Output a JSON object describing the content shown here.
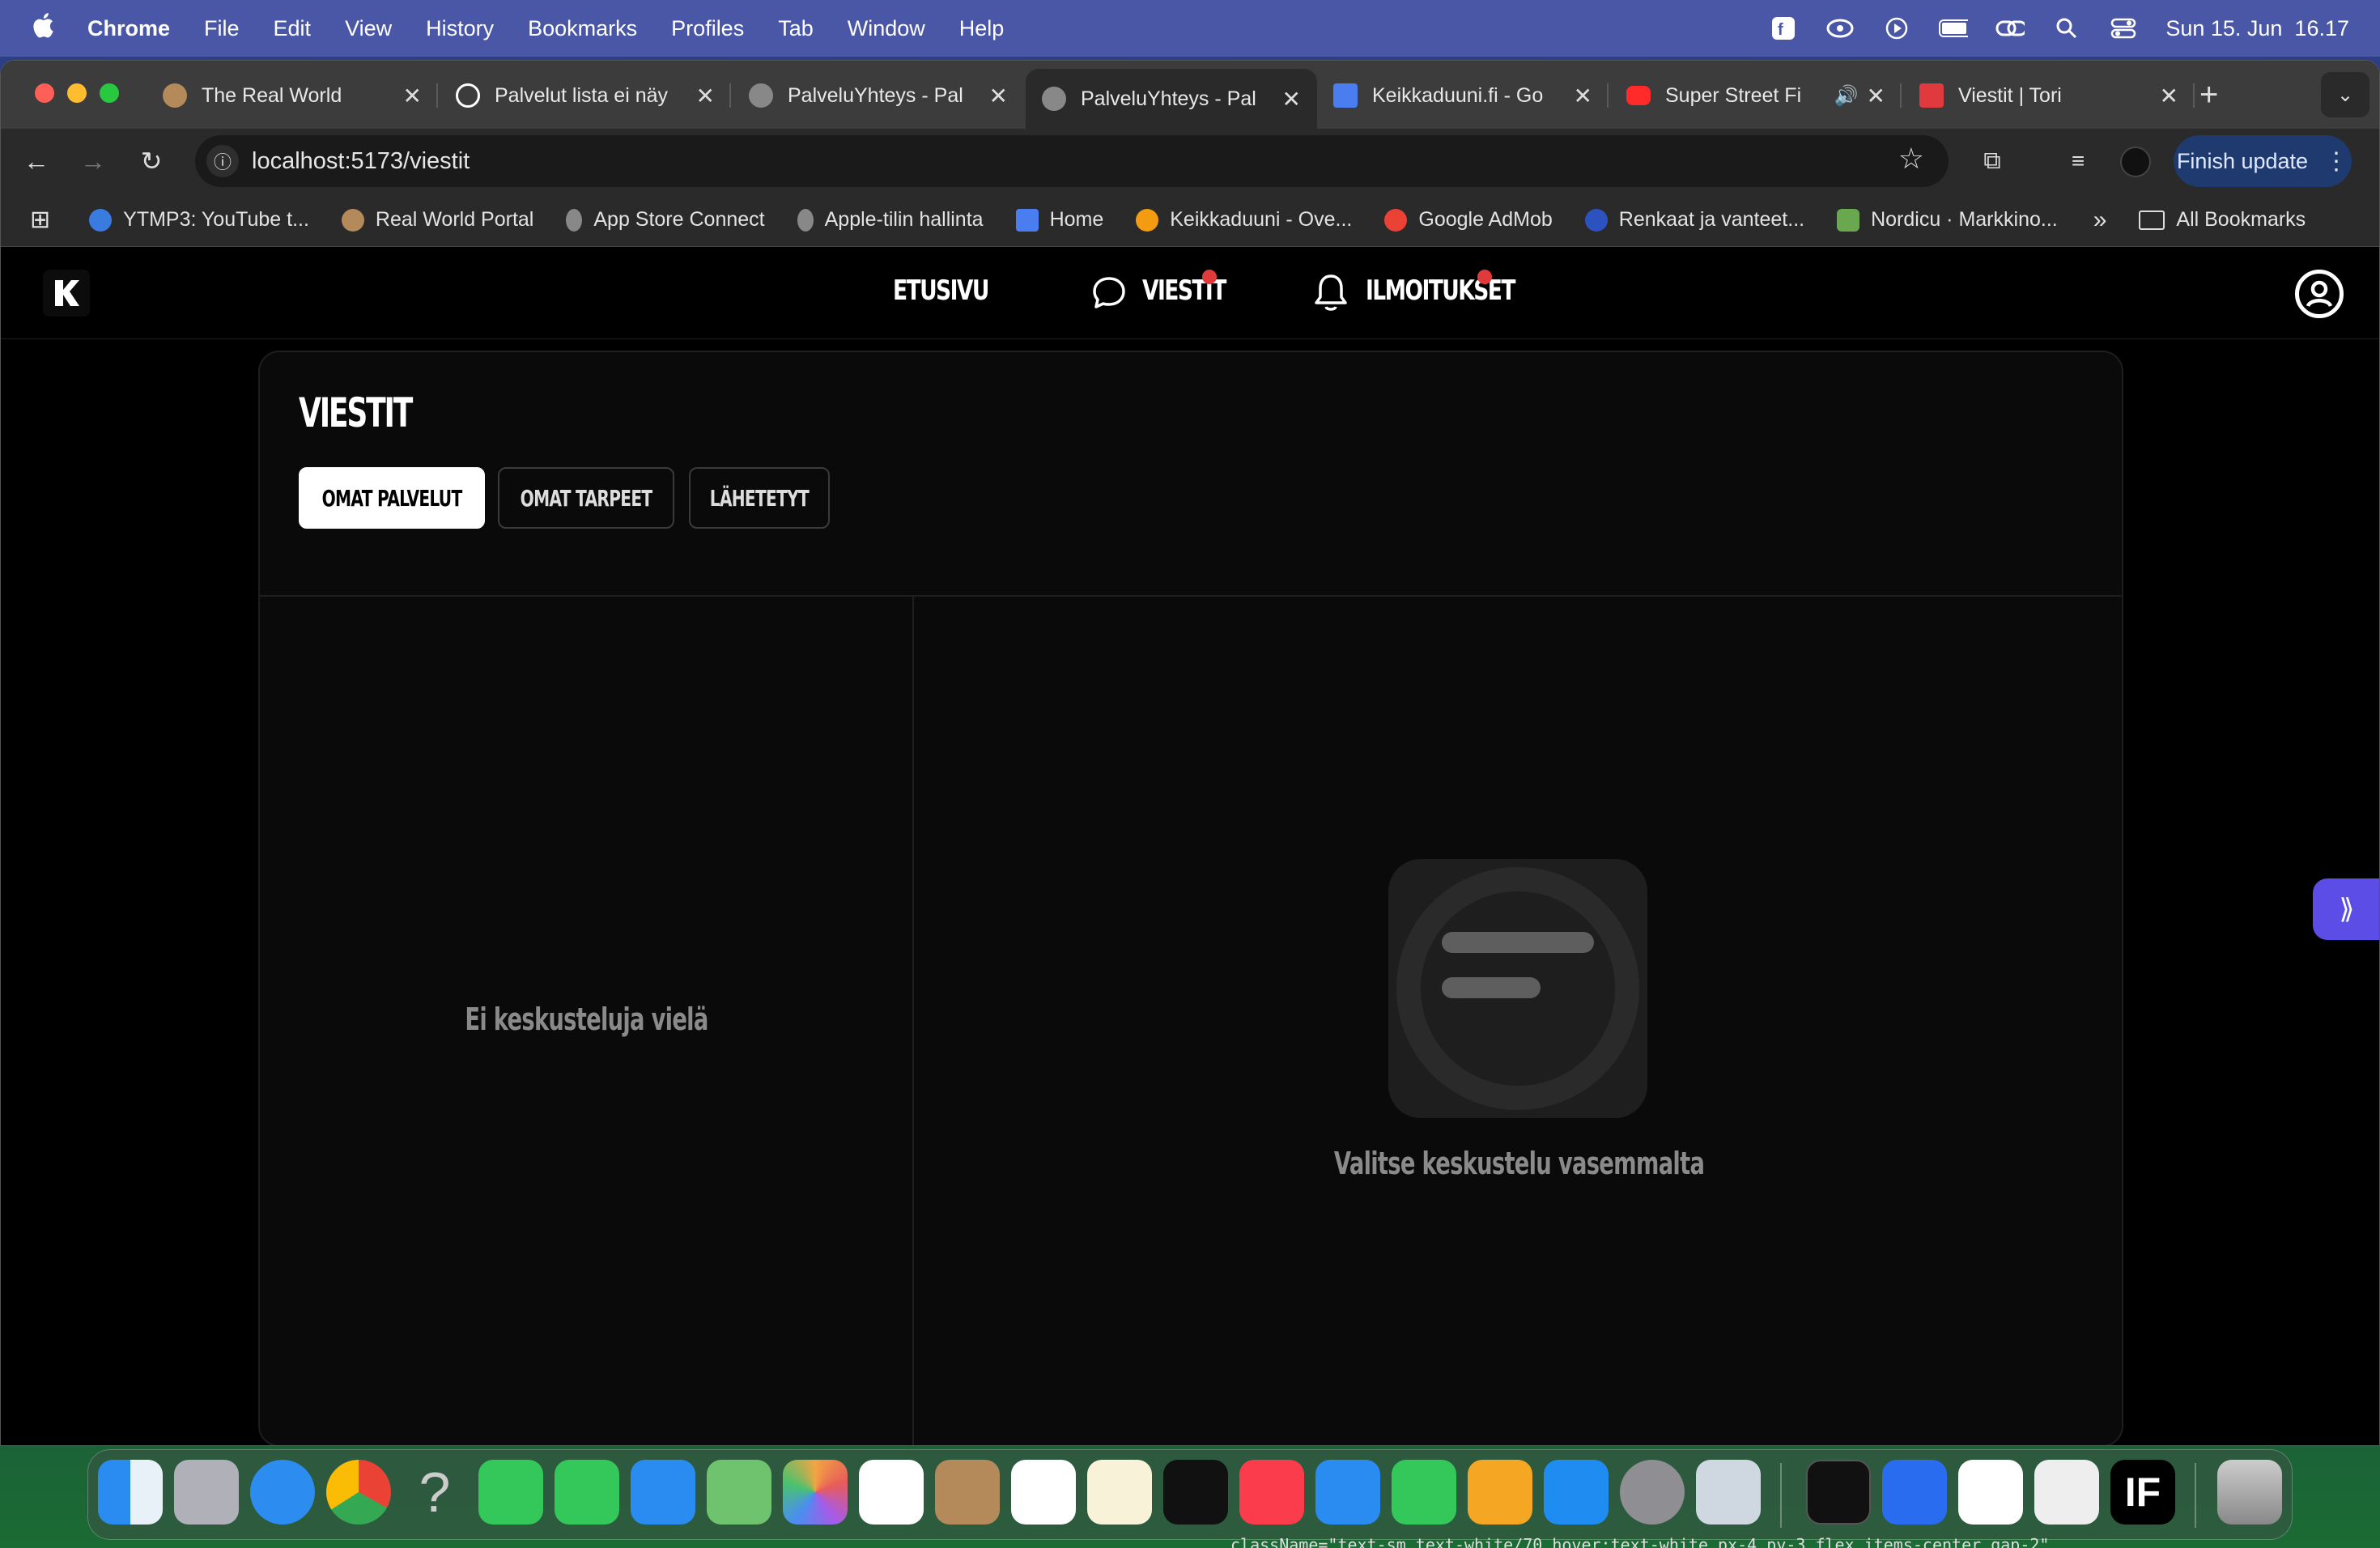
{
  "menubar": {
    "app": "Chrome",
    "items": [
      "File",
      "Edit",
      "View",
      "History",
      "Bookmarks",
      "Profiles",
      "Tab",
      "Window",
      "Help"
    ],
    "clock": "Sun 15. Jun  16.17"
  },
  "tabs": [
    {
      "title": "The Real World",
      "icon": "realworld-favicon"
    },
    {
      "title": "Palvelut lista ei näy",
      "icon": "openai-favicon"
    },
    {
      "title": "PalveluYhteys - Pal",
      "icon": "globe-favicon"
    },
    {
      "title": "PalveluYhteys - Pal",
      "icon": "globe-favicon"
    },
    {
      "title": "Keikkaduuni.fi - Go",
      "icon": "docs-favicon"
    },
    {
      "title": "Super Street Fi",
      "icon": "youtube-favicon"
    },
    {
      "title": "Viestit | Tori",
      "icon": "tori-favicon"
    }
  ],
  "toolbar": {
    "url": "localhost:5173/viestit",
    "update_label": "Finish update"
  },
  "bookmarks": [
    "YTMP3: YouTube t...",
    "Real World Portal",
    "App Store Connect",
    "Apple-tilin hallinta",
    "Home",
    "Keikkaduuni - Ove...",
    "Google AdMob",
    "Renkaat ja vanteet...",
    "Nordicu · Markkino..."
  ],
  "bookmarks_more": "»",
  "bookmarks_all": "All Bookmarks",
  "nav": {
    "home": "ETUSIVU",
    "messages": "VIESTIT",
    "notifications": "ILMOITUKSET",
    "badge_color": "#e03a3a"
  },
  "main": {
    "title": "VIESTIT",
    "tabs": [
      "OMAT PALVELUT",
      "OMAT TARPEET",
      "LÄHETETYT"
    ],
    "active_tab": "OMAT PALVELUT",
    "empty_list": "Ei keskusteluja vielä",
    "empty_detail": "Valitse keskustelu vasemmalta"
  },
  "terminal_snippet": "className=\"text-sm text-white/70 hover:text-white px-4 py-3 flex items-center gap-2\""
}
